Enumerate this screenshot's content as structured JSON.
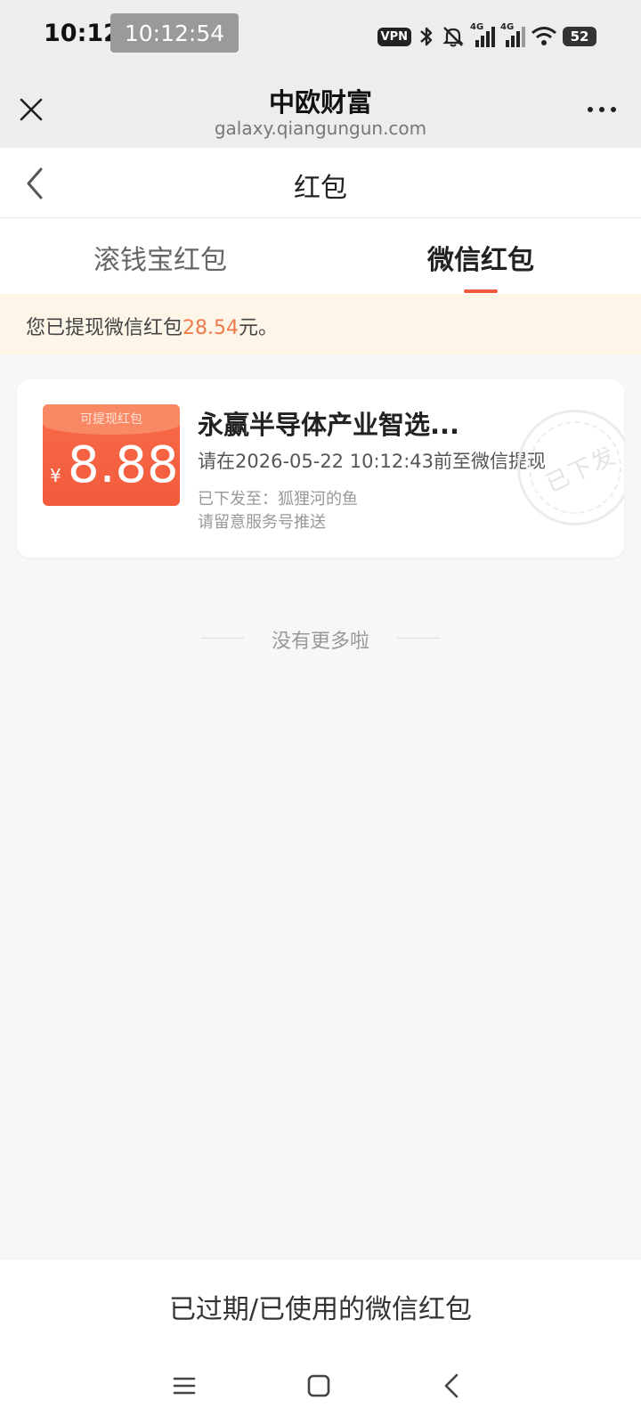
{
  "status_bar": {
    "time": "10:12",
    "clock_badge": "10:12:54",
    "vpn_label": "VPN",
    "network_labels": [
      "4G",
      "4G"
    ],
    "battery": "52"
  },
  "web_header": {
    "title": "中欧财富",
    "url": "galaxy.qiangungun.com"
  },
  "nav": {
    "title": "红包"
  },
  "tabs": [
    {
      "label": "滚钱宝红包",
      "active": false
    },
    {
      "label": "微信红包",
      "active": true
    }
  ],
  "notice": {
    "prefix": "您已提现微信红包",
    "amount": "28.54",
    "suffix": "元。"
  },
  "card": {
    "tag": "可提现红包",
    "currency": "¥",
    "amount": "8.88",
    "title": "永赢半导体产业智选...",
    "deadline": "请在2026-05-22 10:12:43前至微信提现",
    "sent_to": "已下发至：狐狸河的鱼",
    "hint": "请留意服务号推送",
    "stamp": "已下发"
  },
  "list_end": "没有更多啦",
  "bottom_button": "已过期/已使用的微信红包",
  "colors": {
    "accent": "#ef5a3c",
    "coupon": "#f4603f",
    "notice_bg": "#fdf5e8",
    "notice_amount": "#ef7a4c"
  }
}
